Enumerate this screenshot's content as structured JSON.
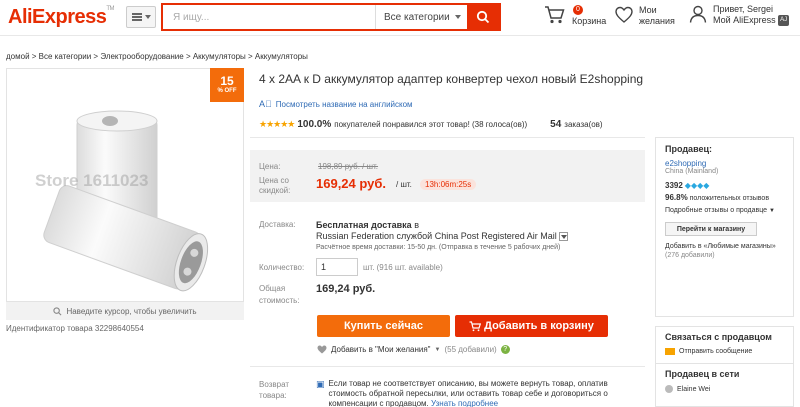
{
  "header": {
    "logo": "AliExpress",
    "logo_tm": "TM",
    "search_placeholder": "Я ищу...",
    "search_category": "Все категории",
    "cart_count": "0",
    "cart_label": "Корзина",
    "wishlist_line1": "Мои",
    "wishlist_line2": "желания",
    "user_line1": "Привет, Sergei",
    "user_badge": "AJ",
    "user_line2": "Мой AliExpress"
  },
  "breadcrumbs": "домой > Все категории > Электрооборудование > Аккумуляторы > Аккумуляторы",
  "gallery": {
    "discount_value": "15",
    "discount_pct": "% OFF",
    "watermark": "Store 1611023",
    "zoom_hint": "Наведите курсор, чтобы увеличить",
    "product_id": "Идентификатор товара 32298640554"
  },
  "product": {
    "title": "4 x 2AA к D аккумулятор адаптер конвертер чехол новый E2shopping",
    "translate_link": "Посмотреть название на английском",
    "stars": "★★★★★",
    "rating_pct": "100.0%",
    "rating_text": "покупателей понравился этот товар! (38 голоса(ов))",
    "orders_count": "54",
    "orders_label": "заказа(ов)"
  },
  "price": {
    "label": "Цена:",
    "old": "198,89 руб. / шт.",
    "sale_label": "Цена со скидкой:",
    "new": "169,24 руб.",
    "unit": "/ шт.",
    "timer": "13h:06m:25s"
  },
  "delivery": {
    "label": "Доставка:",
    "free": "Бесплатная доставка",
    "in": "в",
    "route": "Russian Federation службой China Post Registered Air Mail",
    "time": "Расчётное время доставки: 15-50 дн. (Отправка в течение 5 рабочих дней)"
  },
  "quantity": {
    "label": "Количество:",
    "value": "1",
    "available": "шт. (916 шт. available)"
  },
  "total": {
    "label": "Общая стоимость:",
    "value": "169,24 руб."
  },
  "actions": {
    "buy_now": "Купить сейчас",
    "add_to_cart": "Добавить в корзину",
    "add_wishlist": "Добавить в \"Мои желания\"",
    "wishlist_count": "(55 добавили)"
  },
  "returns": {
    "label": "Возврат товара:",
    "text": "Если товар не соответствует описанию, вы можете вернуть товар, оплатив стоимость обратной пересылки, или оставить товар себе и договориться о компенсации с продавцом.",
    "link": "Узнать подробнее"
  },
  "seller": {
    "heading": "Продавец:",
    "store": "e2shopping",
    "country": "China (Mainland)",
    "score": "3392",
    "feedback_pct": "96.8%",
    "feedback_text": "положительных отзывов",
    "details": "Подробные отзывы о продавце",
    "go_store": "Перейти к магазину",
    "favorites": "Добавить в «Любимые магазины»",
    "favorites_count": "(276 добавили)"
  },
  "contact": {
    "heading": "Связаться с продавцом",
    "send": "Отправить сообщение"
  },
  "online": {
    "heading": "Продавец в сети",
    "person": "Elaine Wei"
  },
  "colors": {
    "brand": "#e62e04",
    "accent": "#f36c0b",
    "link": "#2f6bb5"
  }
}
